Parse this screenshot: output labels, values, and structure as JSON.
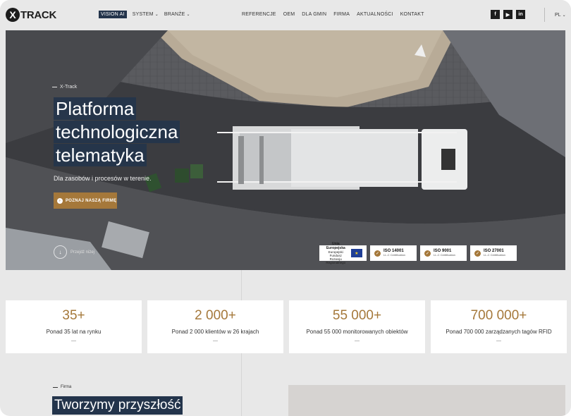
{
  "brand": {
    "logo_mark": "X",
    "logo_text": "TRACK"
  },
  "nav": {
    "left": [
      {
        "label": "VISION AI",
        "active": true,
        "dropdown": false
      },
      {
        "label": "SYSTEM",
        "active": false,
        "dropdown": true
      },
      {
        "label": "BRANŻE",
        "active": false,
        "dropdown": true
      }
    ],
    "right": [
      "REFERENCJE",
      "OEM",
      "DLA GMIN",
      "FIRMA",
      "AKTUALNOŚCI",
      "KONTAKT"
    ]
  },
  "social": {
    "facebook": "f",
    "youtube": "▶",
    "linkedin": "in"
  },
  "language": "PL",
  "hero": {
    "eyebrow": "X-Track",
    "headline_lines": [
      "Platforma",
      "technologiczna",
      "telematyka"
    ],
    "subline": "Dla zasobów i procesów w terenie.",
    "cta_label": "POZNAJ NASZĄ FIRMĘ",
    "scroll_label": "Przejdź niżej"
  },
  "certs": {
    "ue": {
      "title": "Unia Europejska",
      "line1": "Europejski Fundusz",
      "line2": "Rozwoju Regionalnego",
      "flag": "★"
    },
    "iso": [
      {
        "title": "ISO 14001",
        "sub": "LL-C Certification"
      },
      {
        "title": "ISO 9001",
        "sub": "LL-C Certification"
      },
      {
        "title": "ISO 27001",
        "sub": "LL-C Certification"
      }
    ]
  },
  "stats": [
    {
      "value": "35+",
      "label": "Ponad 35 lat na rynku"
    },
    {
      "value": "2 000+",
      "label": "Ponad 2 000 klientów w 26 krajach"
    },
    {
      "value": "55 000+",
      "label": "Ponad 55 000 monitorowanych obiektów"
    },
    {
      "value": "700 000+",
      "label": "Ponad 700 000 zarządzanych tagów RFID"
    }
  ],
  "firma": {
    "eyebrow": "Firma",
    "title": "Tworzymy przyszłość"
  },
  "colors": {
    "accent": "#a5783a",
    "navy": "#23344b",
    "background": "#e8e8e8"
  }
}
